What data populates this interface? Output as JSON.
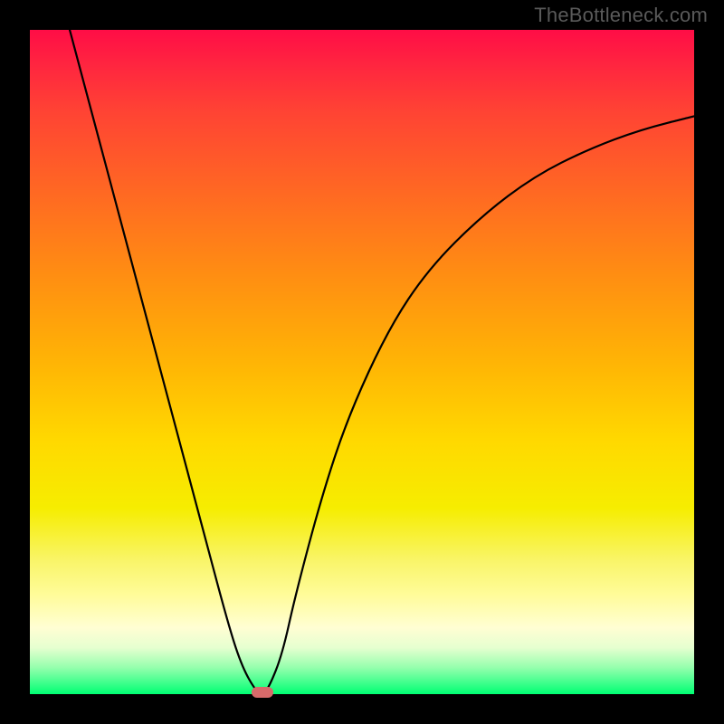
{
  "watermark": "TheBottleneck.com",
  "chart_data": {
    "type": "line",
    "title": "",
    "xlabel": "",
    "ylabel": "",
    "xlim": [
      0,
      100
    ],
    "ylim": [
      0,
      100
    ],
    "series": [
      {
        "name": "curve",
        "x": [
          6,
          10,
          14,
          18,
          22,
          26,
          30,
          32,
          34,
          35,
          36,
          38,
          40,
          44,
          48,
          54,
          60,
          68,
          76,
          84,
          92,
          100
        ],
        "y": [
          100,
          85,
          70,
          55,
          40,
          25,
          10,
          4,
          0.5,
          0,
          1,
          6,
          15,
          30,
          42,
          55,
          64,
          72,
          78,
          82,
          85,
          87
        ]
      }
    ],
    "marker": {
      "x": 35,
      "y": 0.3
    },
    "gradient_stops": [
      {
        "pos": 0,
        "color": "#ff0d46"
      },
      {
        "pos": 50,
        "color": "#ffb405"
      },
      {
        "pos": 80,
        "color": "#fffc99"
      },
      {
        "pos": 100,
        "color": "#00ff73"
      }
    ]
  }
}
